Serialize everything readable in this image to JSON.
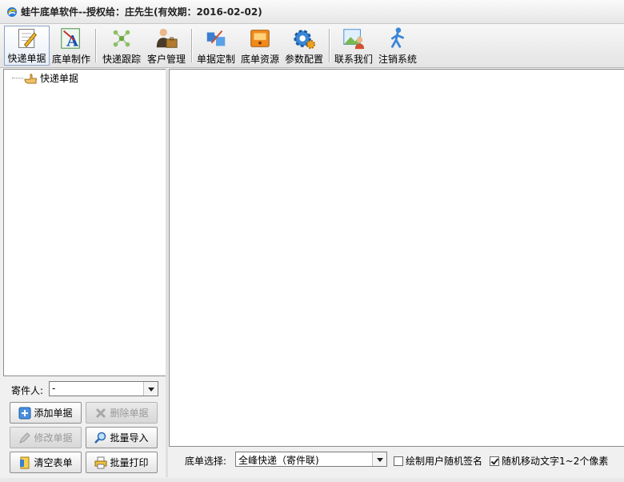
{
  "window": {
    "title": "蛙牛底单软件--授权给：庄先生(有效期：2016-02-02)",
    "icon": "app-swirl-icon"
  },
  "toolbar": {
    "items": [
      {
        "label": "快递单据",
        "icon": "edit-form-icon",
        "active": true
      },
      {
        "label": "底单制作",
        "icon": "text-design-icon"
      },
      {
        "label": "快递跟踪",
        "icon": "network-nodes-icon"
      },
      {
        "label": "客户管理",
        "icon": "customer-briefcase-icon"
      },
      {
        "label": "单据定制",
        "icon": "puzzle-pieces-icon"
      },
      {
        "label": "底单资源",
        "icon": "orange-box-icon"
      },
      {
        "label": "参数配置",
        "icon": "gears-icon"
      },
      {
        "label": "联系我们",
        "icon": "contact-person-icon"
      },
      {
        "label": "注销系统",
        "icon": "walking-person-icon"
      }
    ]
  },
  "tree": {
    "root_label": "快递单据",
    "root_icon": "hand-pointer-icon"
  },
  "sender": {
    "label": "寄件人:",
    "value": "-"
  },
  "buttons": {
    "add": "添加单据",
    "delete": "删除单据",
    "edit": "修改单据",
    "import": "批量导入",
    "clear": "清空表单",
    "print": "批量打印"
  },
  "bottom": {
    "template_label": "底单选择:",
    "template_value": "全峰快递（寄件联)",
    "random_sign_label": "绘制用户随机签名",
    "random_sign_checked": false,
    "random_move_label": "随机移动文字1~2个像素",
    "random_move_checked": true
  }
}
